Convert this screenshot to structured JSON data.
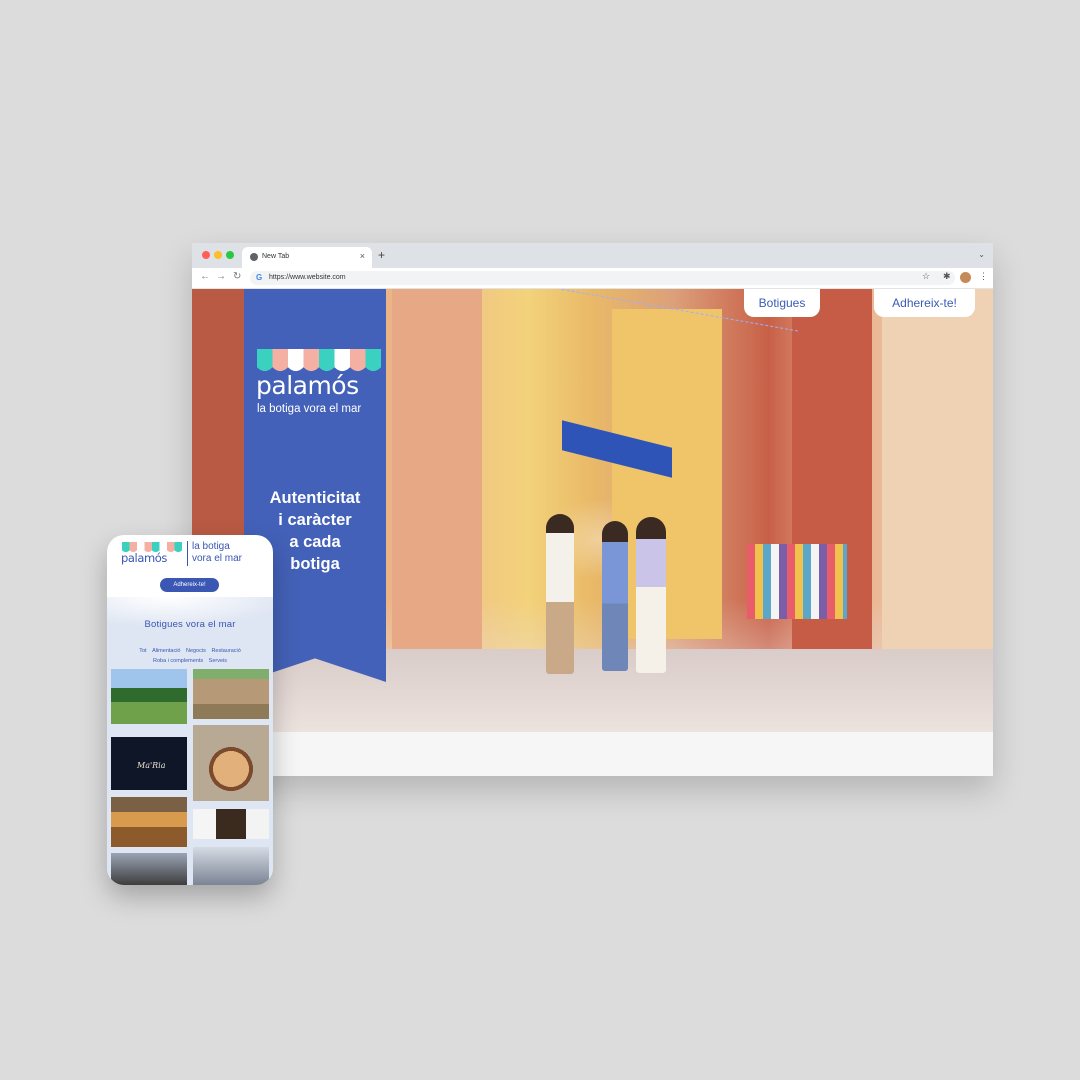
{
  "browser": {
    "tab_title": "New Tab",
    "new_tab_symbol": "+",
    "tab_close_symbol": "×",
    "url": "https://www.website.com",
    "back_symbol": "←",
    "forward_symbol": "→",
    "reload_symbol": "↻",
    "star_symbol": "☆",
    "extensions_symbol": "✱",
    "menu_symbol": "⋮",
    "tabstrip_chevron": "⌄"
  },
  "site": {
    "brand": {
      "name": "palamós",
      "tagline": "la botiga vora el mar",
      "awning_colors": [
        "#3bd1c1",
        "#f4b0a3",
        "#ffffff",
        "#f4b0a3",
        "#3bd1c1",
        "#ffffff",
        "#f4b0a3",
        "#3bd1c1"
      ]
    },
    "nav": {
      "botigues": "Botigues",
      "adhereix": "Adhereix-te!"
    },
    "hero_heading": "Autenticitat\ni caràcter\na cada\nbotiga",
    "panel_color": "#4361b8"
  },
  "mobile": {
    "brand_name": "palamós",
    "tagline": "la botiga\nvora el mar",
    "cta": "Adhereix-te!",
    "section_title": "Botigues vora el mar",
    "filters": [
      "Tot",
      "Alimentació",
      "Negocis",
      "Restauració",
      "Roba i complements",
      "Serveis"
    ],
    "tile_logo_text": "Ma'Ria"
  }
}
